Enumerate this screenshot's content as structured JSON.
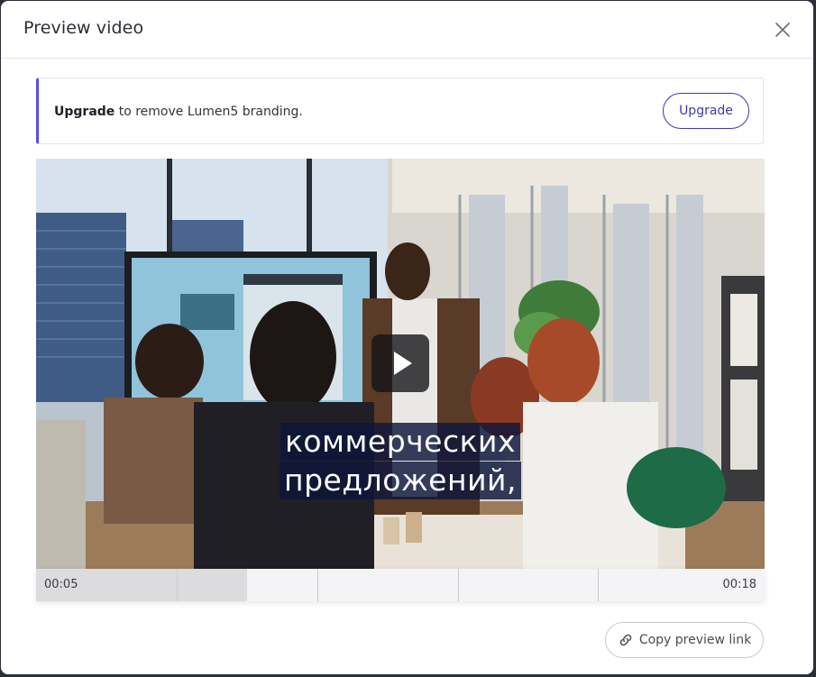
{
  "dialog": {
    "title": "Preview video"
  },
  "banner": {
    "strong": "Upgrade",
    "rest": " to remove Lumen5 branding.",
    "button_label": "Upgrade"
  },
  "video": {
    "subtitle_lines": [
      "коммерческих",
      "предложений,"
    ],
    "current_time": "00:05",
    "duration": "00:18",
    "progress_fraction": 0.29
  },
  "footer": {
    "copy_link_label": "Copy preview link"
  },
  "colors": {
    "accent": "#3f3aa8",
    "banner_border": "#5b4fd6",
    "subtitle_bg": "#0e163a"
  },
  "icons": {
    "close": "close-icon",
    "play": "play-icon",
    "link": "link-icon"
  }
}
